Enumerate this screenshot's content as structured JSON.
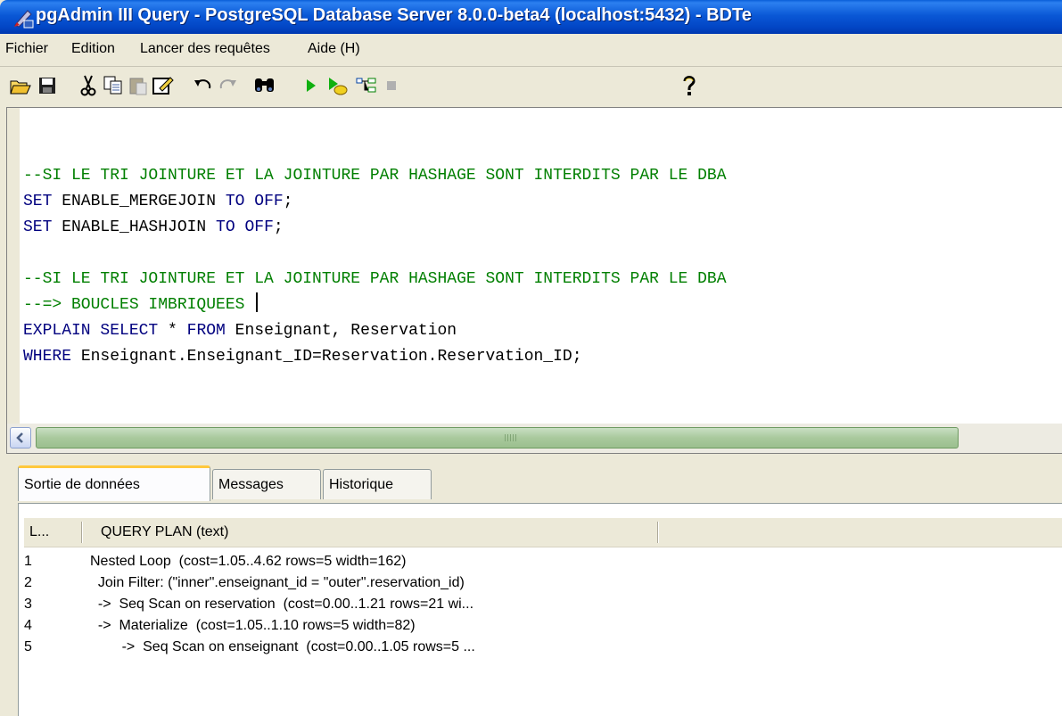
{
  "window": {
    "title": "pgAdmin III Query - PostgreSQL Database Server 8.0.0-beta4 (localhost:5432) - BDTe"
  },
  "menu": {
    "items": [
      "Fichier",
      "Edition",
      "Lancer des requêtes",
      "Aide (H)"
    ]
  },
  "toolbar": {
    "icons": [
      "open-folder-icon",
      "save-icon",
      "cut-icon",
      "copy-icon",
      "paste-icon",
      "edit-icon",
      "undo-icon",
      "redo-icon",
      "find-icon",
      "execute-icon",
      "execute-to-file-icon",
      "explain-icon",
      "stop-icon",
      "help-icon"
    ]
  },
  "editor": {
    "lines": [
      {
        "parts": [
          {
            "t": "--SI LE TRI JOINTURE ET LA JOINTURE PAR HASHAGE SONT INTERDITS PAR LE DBA",
            "c": "comment"
          }
        ]
      },
      {
        "parts": [
          {
            "t": "SET",
            "c": "kw"
          },
          {
            "t": " ENABLE_MERGEJOIN ",
            "c": ""
          },
          {
            "t": "TO",
            "c": "kw"
          },
          {
            "t": " ",
            "c": ""
          },
          {
            "t": "OFF",
            "c": "kw"
          },
          {
            "t": ";",
            "c": ""
          }
        ]
      },
      {
        "parts": [
          {
            "t": "SET",
            "c": "kw"
          },
          {
            "t": " ENABLE_HASHJOIN ",
            "c": ""
          },
          {
            "t": "TO",
            "c": "kw"
          },
          {
            "t": " ",
            "c": ""
          },
          {
            "t": "OFF",
            "c": "kw"
          },
          {
            "t": ";",
            "c": ""
          }
        ]
      },
      {
        "parts": [
          {
            "t": "",
            "c": ""
          }
        ]
      },
      {
        "parts": [
          {
            "t": "--SI LE TRI JOINTURE ET LA JOINTURE PAR HASHAGE SONT INTERDITS PAR LE DBA",
            "c": "comment"
          }
        ]
      },
      {
        "parts": [
          {
            "t": "--=> BOUCLES IMBRIQUEES ",
            "c": "comment"
          }
        ],
        "caret": true
      },
      {
        "parts": [
          {
            "t": "EXPLAIN SELECT",
            "c": "kw"
          },
          {
            "t": " * ",
            "c": ""
          },
          {
            "t": "FROM",
            "c": "kw"
          },
          {
            "t": " Enseignant, Reservation",
            "c": ""
          }
        ]
      },
      {
        "parts": [
          {
            "t": "WHERE",
            "c": "kw"
          },
          {
            "t": " Enseignant.Enseignant_ID=Reservation.Reservation_ID;",
            "c": ""
          }
        ]
      }
    ]
  },
  "tabs": {
    "output": "Sortie de données",
    "messages": "Messages",
    "history": "Historique"
  },
  "results": {
    "columns": [
      "L...",
      "QUERY PLAN (text)"
    ],
    "rows": [
      {
        "num": "1",
        "text": "Nested Loop  (cost=1.05..4.62 rows=5 width=162)"
      },
      {
        "num": "2",
        "text": "  Join Filter: (\"inner\".enseignant_id = \"outer\".reservation_id)"
      },
      {
        "num": "3",
        "text": "  ->  Seq Scan on reservation  (cost=0.00..1.21 rows=21 wi..."
      },
      {
        "num": "4",
        "text": "  ->  Materialize  (cost=1.05..1.10 rows=5 width=82)"
      },
      {
        "num": "5",
        "text": "        ->  Seq Scan on enseignant  (cost=0.00..1.05 rows=5 ..."
      }
    ]
  },
  "scrollbar": {
    "grip": "III"
  }
}
